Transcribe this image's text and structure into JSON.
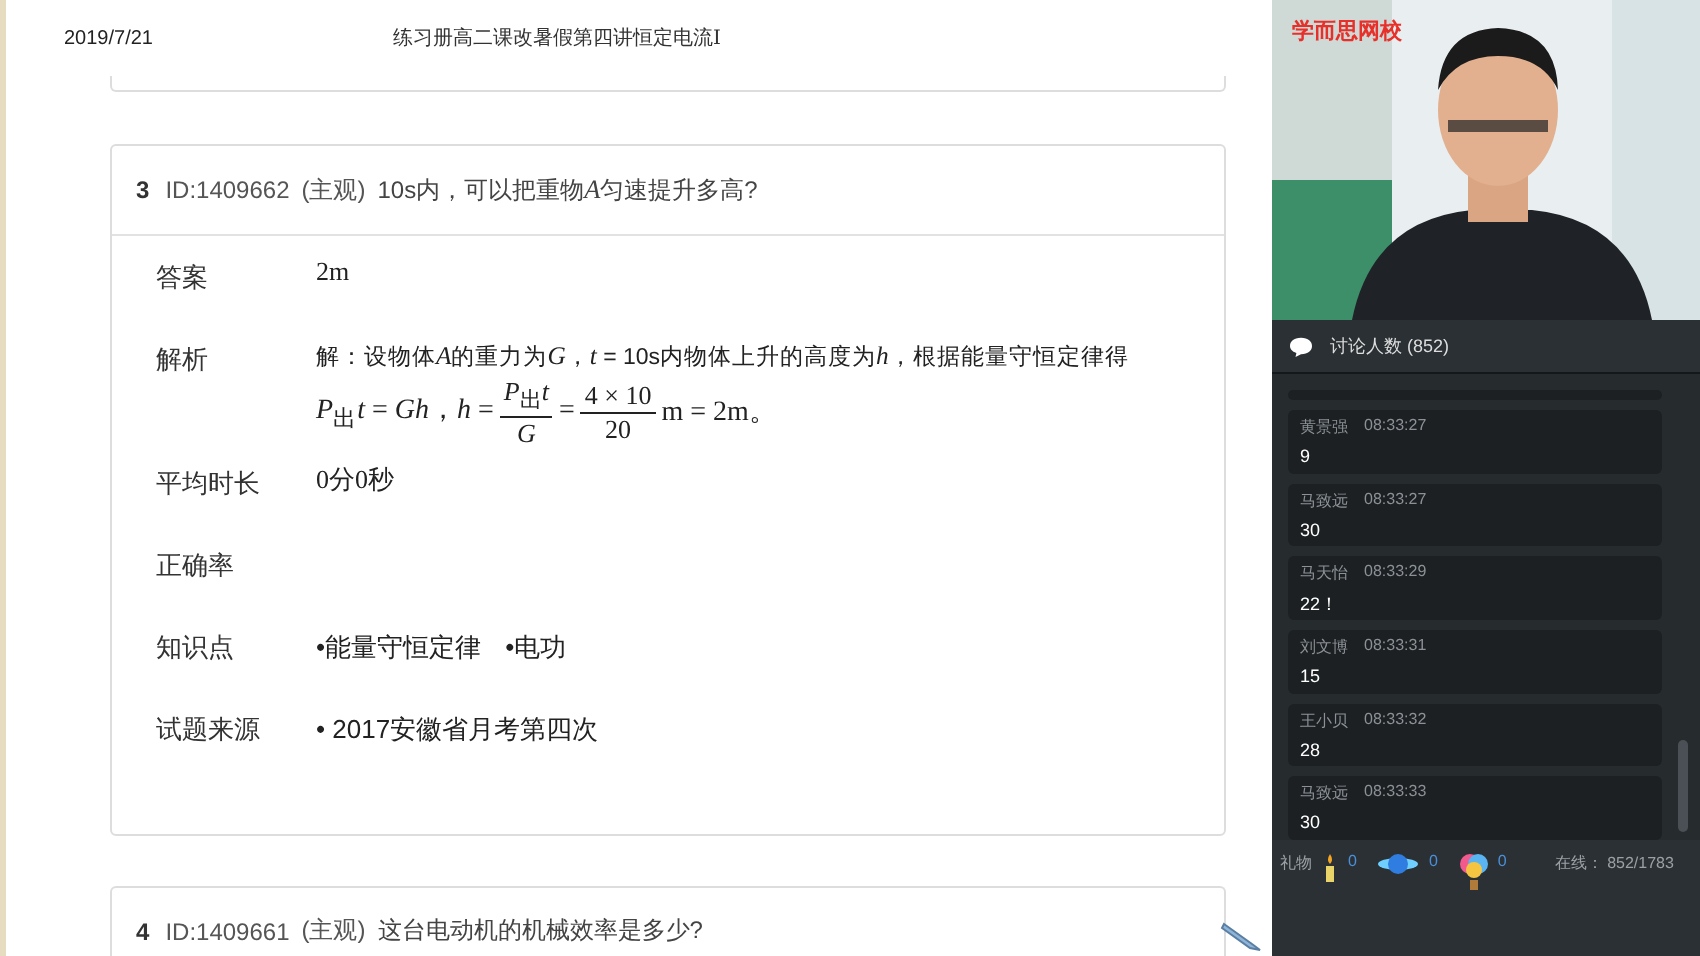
{
  "header": {
    "date": "2019/7/21",
    "title": "练习册高二课改暑假第四讲恒定电流I"
  },
  "questions": [
    {
      "number": "3",
      "id": "ID:1409662",
      "type": "(主观)",
      "stem": [
        {
          "kind": "text",
          "text": "10s内，可以把重物"
        },
        {
          "kind": "var",
          "text": "A"
        },
        {
          "kind": "text",
          "text": "匀速提升多高?"
        }
      ],
      "rows": [
        {
          "kind": "text",
          "label": "答案",
          "value": "2m"
        },
        {
          "kind": "solution",
          "label": "解析",
          "line": [
            {
              "kind": "text",
              "text": "解：设物体"
            },
            {
              "kind": "var",
              "text": "A"
            },
            {
              "kind": "text",
              "text": "的重力为"
            },
            {
              "kind": "var",
              "text": "G"
            },
            {
              "kind": "text",
              "text": "，"
            },
            {
              "kind": "var",
              "text": "t"
            },
            {
              "kind": "text",
              "text": " = 10s内物体上升的高度为"
            },
            {
              "kind": "var",
              "text": "h"
            },
            {
              "kind": "text",
              "text": "，根据能量守恒定律得"
            }
          ],
          "segments": [
            {
              "kind": "text",
              "text": "*P*$_{出}$*t* = *Gh*，*h* = "
            },
            {
              "kind": "frac",
              "num": "*P*$_{出}$*t*",
              "den": "*G*"
            },
            {
              "kind": "text",
              "text": " = "
            },
            {
              "kind": "frac",
              "num": "4 × 10",
              "den": "20"
            },
            {
              "kind": "text",
              "text": "m = 2m。"
            }
          ]
        },
        {
          "kind": "text",
          "label": "平均时长",
          "value": "0分0秒"
        },
        {
          "kind": "text",
          "label": "正确率"
        },
        {
          "kind": "tags",
          "label": "知识点",
          "items": [
            "•能量守恒定律",
            "•电功"
          ]
        },
        {
          "kind": "tags",
          "label": "试题来源",
          "items": [
            "• 2017安徽省月考第四次"
          ]
        }
      ]
    },
    {
      "number": "4",
      "id": "ID:1409661",
      "type": "(主观)",
      "stem": [
        {
          "kind": "text",
          "text": "这台电动机的机械效率是多少?"
        }
      ]
    }
  ],
  "video": {
    "logo": "学而思网校"
  },
  "chat": {
    "title": "讨论人数 (852)",
    "messages": [
      {
        "name": "黄景强",
        "time": "08:33:27",
        "text": "9"
      },
      {
        "name": "马致远",
        "time": "08:33:27",
        "text": "30"
      },
      {
        "name": "马天怡",
        "time": "08:33:29",
        "text": "22！"
      },
      {
        "name": "刘文博",
        "time": "08:33:31",
        "text": "15"
      },
      {
        "name": "王小贝",
        "time": "08:33:32",
        "text": "28"
      },
      {
        "name": "马致远",
        "time": "08:33:33",
        "text": "30"
      }
    ]
  },
  "footer": {
    "gift_label": "礼物",
    "gifts": [
      {
        "kind": "candle",
        "count": "0"
      },
      {
        "kind": "planet",
        "count": "0"
      },
      {
        "kind": "balloon",
        "count": "0"
      }
    ],
    "online": "在线：  852/1783"
  }
}
